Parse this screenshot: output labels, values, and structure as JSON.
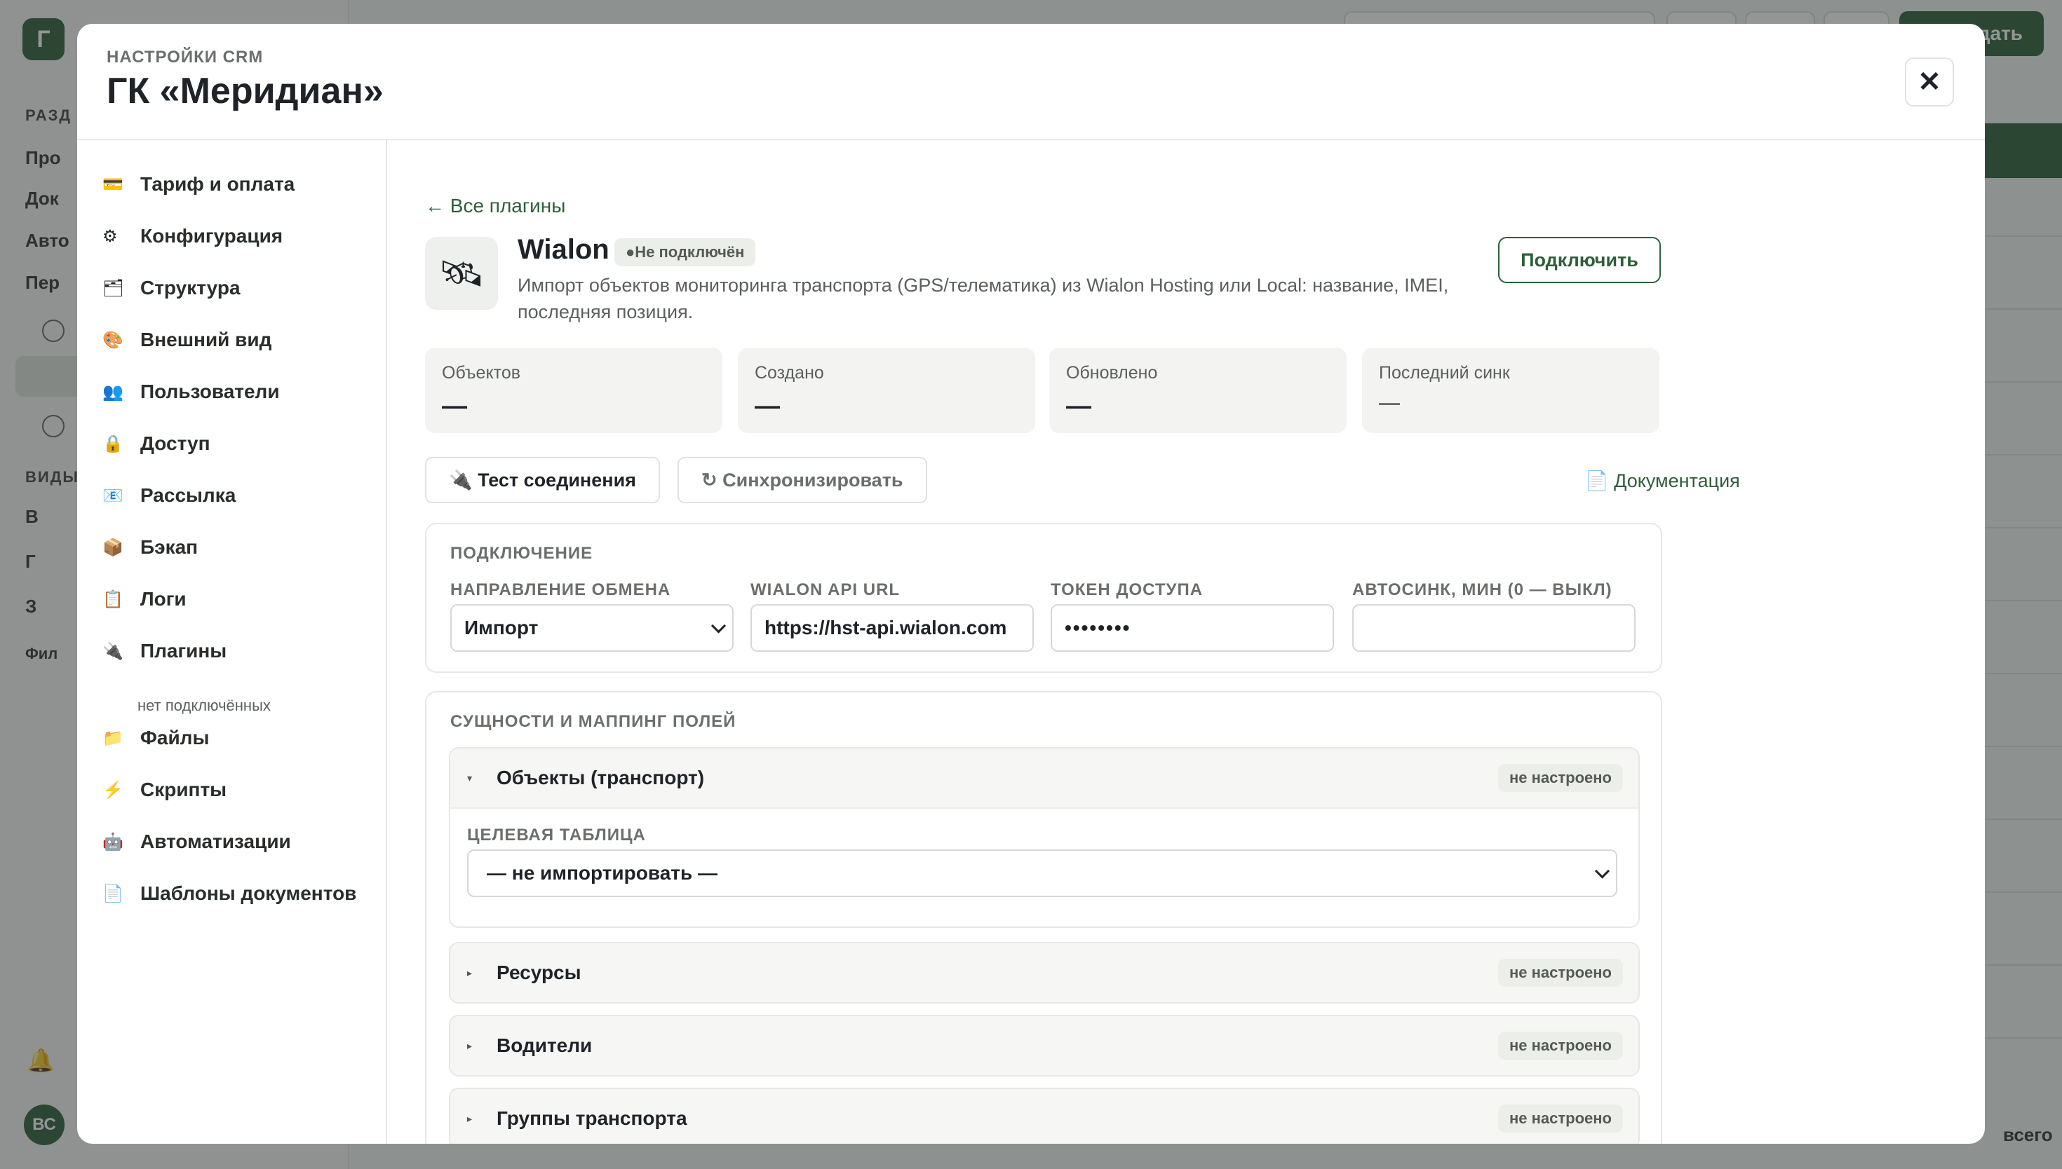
{
  "background": {
    "logo_letter": "Г",
    "section_label": "РАЗД",
    "nav_items": [
      "Про",
      "Док",
      "Авто",
      "Пер"
    ],
    "views_label": "ВИДЫ",
    "view_items": [
      "В",
      "Г",
      "З"
    ],
    "filter_label": "Фил",
    "avatar_initials": "ВС",
    "create_button": "дать",
    "total_label": "всего"
  },
  "modal": {
    "subtitle": "НАСТРОЙКИ CRM",
    "title": "ГК «Меридиан»",
    "close_glyph": "✕"
  },
  "nav": {
    "items": [
      {
        "icon": "💳",
        "label": "Тариф и оплата"
      },
      {
        "icon": "⚙",
        "label": "Конфигурация"
      },
      {
        "icon": "🗂",
        "label": "Структура"
      },
      {
        "icon": "🎨",
        "label": "Внешний вид"
      },
      {
        "icon": "👥",
        "label": "Пользователи"
      },
      {
        "icon": "🔒",
        "label": "Доступ"
      },
      {
        "icon": "📧",
        "label": "Рассылка"
      },
      {
        "icon": "📦",
        "label": "Бэкап"
      },
      {
        "icon": "📋",
        "label": "Логи"
      },
      {
        "icon": "🔌",
        "label": "Плагины"
      },
      {
        "icon": "📁",
        "label": "Файлы"
      },
      {
        "icon": "⚡",
        "label": "Скрипты"
      },
      {
        "icon": "🤖",
        "label": "Автоматизации"
      },
      {
        "icon": "📄",
        "label": "Шаблоны документов"
      }
    ],
    "plugins_note": "нет подключённых"
  },
  "plugin": {
    "back_link": "← Все плагины",
    "logo_icon": "🛰",
    "name": "Wialon",
    "status": "●Не подключён",
    "description": "Импорт объектов мониторинга транспорта (GPS/телематика) из Wialon Hosting или Local: название, IMEI, последняя позиция.",
    "connect_button": "Подключить",
    "stats": [
      {
        "label": "Объектов",
        "value": "—"
      },
      {
        "label": "Создано",
        "value": "—"
      },
      {
        "label": "Обновлено",
        "value": "—"
      },
      {
        "label": "Последний синк",
        "value": "—"
      }
    ],
    "test_button": "🔌 Тест соединения",
    "sync_button": "↻ Синхронизировать",
    "docs_link": "📄 Документация"
  },
  "connection": {
    "title": "ПОДКЛЮЧЕНИЕ",
    "fields": {
      "direction": {
        "label": "НАПРАВЛЕНИЕ ОБМЕНА",
        "value": "Импорт"
      },
      "api_url": {
        "label": "WIALON API URL",
        "value": "https://hst-api.wialon.com"
      },
      "token": {
        "label": "ТОКЕН ДОСТУПА",
        "value": "••••••••"
      },
      "autosync": {
        "label": "АВТОСИНК, МИН (0 — ВЫКЛ)",
        "value": ""
      }
    }
  },
  "mapping": {
    "title": "СУЩНОСТИ И МАППИНГ ПОЛЕЙ",
    "target_label": "ЦЕЛЕВАЯ ТАБЛИЦА",
    "target_value": "— не импортировать —",
    "entities": [
      {
        "toggle": "▾",
        "name": "Объекты (транспорт)",
        "status": "не настроено"
      },
      {
        "toggle": "▸",
        "name": "Ресурсы",
        "status": "не настроено"
      },
      {
        "toggle": "▸",
        "name": "Водители",
        "status": "не настроено"
      },
      {
        "toggle": "▸",
        "name": "Группы транспорта",
        "status": "не настроено"
      }
    ]
  },
  "colors": {
    "accent": "#2e5e3a",
    "muted": "#6b6f6c",
    "overlay": "rgba(40,46,44,0.5)"
  }
}
